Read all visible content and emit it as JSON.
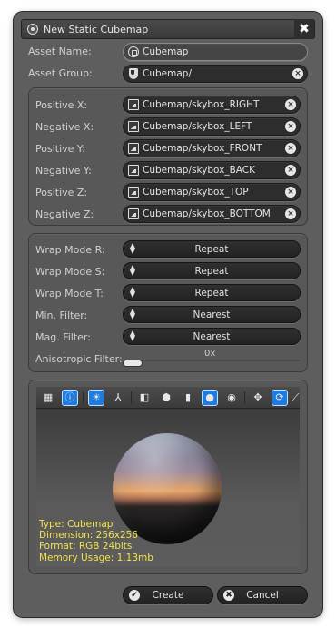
{
  "window": {
    "title": "New Static Cubemap",
    "close_glyph": "✖"
  },
  "asset": {
    "name_label": "Asset Name:",
    "name_value": "Cubemap",
    "group_label": "Asset Group:",
    "group_value": "Cubemap/"
  },
  "faces": [
    {
      "label": "Positive X:",
      "value": "Cubemap/skybox_RIGHT"
    },
    {
      "label": "Negative X:",
      "value": "Cubemap/skybox_LEFT"
    },
    {
      "label": "Positive Y:",
      "value": "Cubemap/skybox_FRONT"
    },
    {
      "label": "Negative Y:",
      "value": "Cubemap/skybox_BACK"
    },
    {
      "label": "Positive Z:",
      "value": "Cubemap/skybox_TOP"
    },
    {
      "label": "Negative Z:",
      "value": "Cubemap/skybox_BOTTOM"
    }
  ],
  "sampling": {
    "wrap_r": {
      "label": "Wrap Mode R:",
      "value": "Repeat"
    },
    "wrap_s": {
      "label": "Wrap Mode S:",
      "value": "Repeat"
    },
    "wrap_t": {
      "label": "Wrap Mode T:",
      "value": "Repeat"
    },
    "min_filter": {
      "label": "Min. Filter:",
      "value": "Nearest"
    },
    "mag_filter": {
      "label": "Mag. Filter:",
      "value": "Nearest"
    },
    "anisotropic": {
      "label": "Anisotropic Filter:",
      "value": "0x",
      "level": 0
    }
  },
  "preview": {
    "info": {
      "type": "Type: Cubemap",
      "dimension": "Dimension: 256x256",
      "format": "Format: RGB 24bits",
      "memory": "Memory Usage: 1.13mb"
    }
  },
  "buttons": {
    "create": "Create",
    "cancel": "Cancel"
  },
  "colors": {
    "accent": "#1e7be0",
    "info_text": "#f3e24a",
    "window_bg": "#5e5e5e"
  }
}
